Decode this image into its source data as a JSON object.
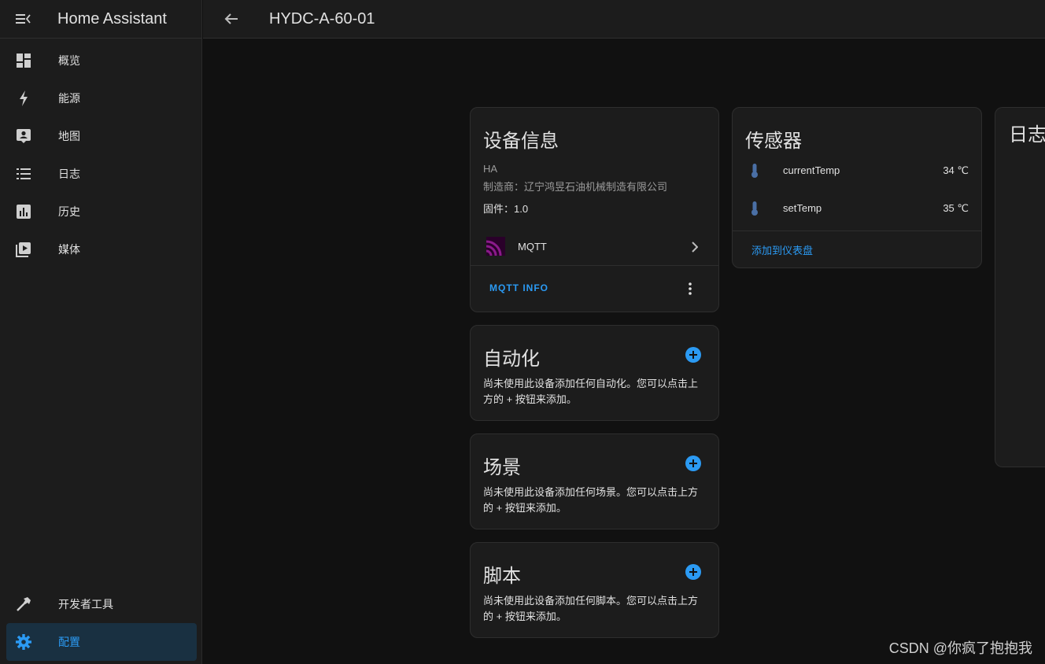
{
  "app": {
    "title": "Home Assistant"
  },
  "sidebar": {
    "items": [
      {
        "label": "概览",
        "icon": "dashboard-icon"
      },
      {
        "label": "能源",
        "icon": "lightning-icon"
      },
      {
        "label": "地图",
        "icon": "map-account-icon"
      },
      {
        "label": "日志",
        "icon": "format-list-icon"
      },
      {
        "label": "历史",
        "icon": "chart-box-icon"
      },
      {
        "label": "媒体",
        "icon": "play-box-icon"
      }
    ],
    "bottom_items": [
      {
        "label": "开发者工具",
        "icon": "hammer-icon"
      },
      {
        "label": "配置",
        "icon": "gear-icon",
        "active": true
      }
    ]
  },
  "header": {
    "title": "HYDC-A-60-01"
  },
  "device_info": {
    "title": "设备信息",
    "model": "HA",
    "manufacturer": "制造商：辽宁鸿昱石油机械制造有限公司",
    "firmware": "固件：1.0",
    "integration": "MQTT",
    "action": "MQTT INFO"
  },
  "sensors": {
    "title": "传感器",
    "items": [
      {
        "name": "currentTemp",
        "value": "34 ℃"
      },
      {
        "name": "setTemp",
        "value": "35 ℃"
      }
    ],
    "add_link": "添加到仪表盘"
  },
  "logbook": {
    "title": "日志"
  },
  "automation": {
    "title": "自动化",
    "description": "尚未使用此设备添加任何自动化。您可以点击上方的 + 按钮来添加。"
  },
  "scene": {
    "title": "场景",
    "description": "尚未使用此设备添加任何场景。您可以点击上方的 + 按钮来添加。"
  },
  "script": {
    "title": "脚本",
    "description": "尚未使用此设备添加任何脚本。您可以点击上方的 + 按钮来添加。"
  },
  "watermark": "CSDN @你疯了抱抱我",
  "colors": {
    "background": "#111111",
    "surface": "#1c1c1c",
    "accent": "#2b9af3",
    "active_bg": "#193041",
    "mqtt_purple": "#660066",
    "sensor_icon": "#4a6fa5"
  }
}
